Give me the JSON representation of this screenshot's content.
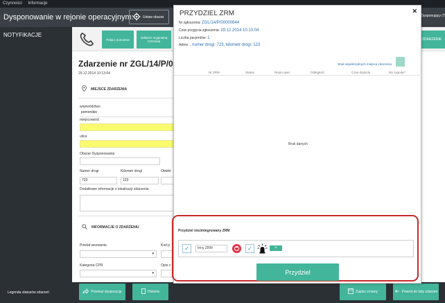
{
  "menubar": {
    "items": [
      "Czynności",
      "Informacje"
    ]
  },
  "header": {
    "title": "Dysponowanie w rejonie operacyjnym:",
    "set_area_button": "Ustaw obszar",
    "user": "Dysponujący (T"
  },
  "sidebar": {
    "notifications": "NOTYFIKACJE",
    "legend": "Legenda statusów zdarzeń"
  },
  "toolbar": {
    "buttons": [
      "Połącz ponownie",
      "Odtwórz oryginalną rozmowę"
    ],
    "right_button": "ZDARZENIE"
  },
  "incident": {
    "title": "Zdarzenie nr  ZGL/14/P/00",
    "datetime": "29.12.2014 10:13:04",
    "location_section": "MIEJSCE ZDARZENIA",
    "fields": {
      "voivodeship_label": "województwo",
      "voivodeship_value": "pomorskie",
      "city_label": "miejscowość",
      "street_label": "ulica",
      "dispatch_area_label": "Obszar Dysponowania",
      "road_no_label": "Numer drogi",
      "road_no_value": "723",
      "km_label": "Kilometr drogi",
      "km_value": "123",
      "object_label": "Obiekt",
      "extra_info_label": "Dodatkowe informacje o lokalizacji zdarzenia"
    },
    "info_section": "INFORMACJE O ZDARZENIU",
    "call_reason_label": "Powód wezwania",
    "code_label": "Kod p",
    "cpr_label": "Kategoria CPR",
    "desc_label": "Opis z"
  },
  "bottombar": {
    "forward_button": "Przekaż dyspozycję",
    "history_button": "Historia",
    "save_button": "Zapisz zmiany",
    "back_button": "Powrót do listy zdarzeń"
  },
  "modal": {
    "title": "PRZYDZIEL ZRM",
    "close": "✕",
    "report_no_label": "Nr zgłoszenia:",
    "report_no_value": "ZGL/14/P/00000844",
    "time_label": "Czas przyjęcia zgłoszenia:",
    "time_value": "29.12.2014 10:13:04",
    "patients_label": "Liczba pacjentów:",
    "patients_value": "1",
    "address_label": "Adres:",
    "address_value": ", numer drogi: 723, kilometr drogi: 123",
    "no_coords_link": "Brak współrzędnych miejsca zdarzenia",
    "table_headers": [
      "Nr ZRM",
      "Status",
      "Rejon oper.",
      "Odległość",
      "Czas dojazdu",
      "Na zygodę?"
    ],
    "no_data": "Brak danych",
    "nonintegrated_title": "Przydziel niezintegrowany ZRM",
    "zrm_input_value": "Inny ZRM",
    "plus_button": "+",
    "assign_button": "Przydziel",
    "checkmark": "✓"
  },
  "colors": {
    "accent": "#43b59b",
    "highlight": "#c82a2a",
    "link": "#2a6fb5",
    "required_field": "#fbfb6e"
  }
}
